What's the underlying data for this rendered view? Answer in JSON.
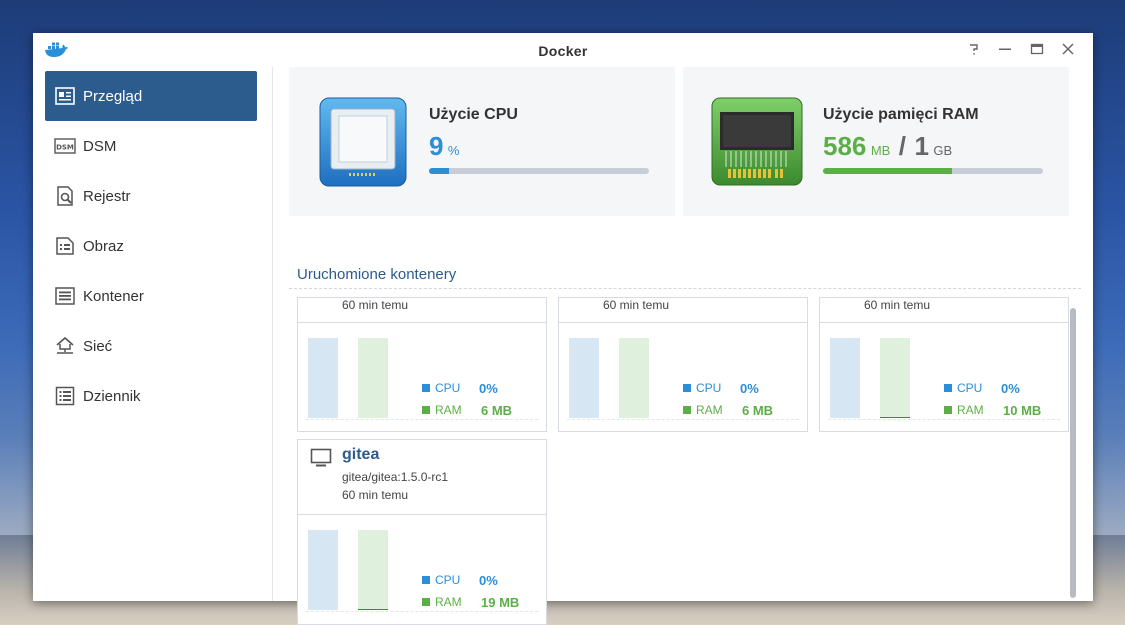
{
  "window": {
    "title": "Docker"
  },
  "colors": {
    "accent": "#2c5b8e",
    "cpu": "#2a8fd6",
    "ram": "#5caf47"
  },
  "sidebar": {
    "items": [
      {
        "label": "Przegląd",
        "icon": "overview-icon",
        "active": true
      },
      {
        "label": "DSM",
        "icon": "dsm-icon"
      },
      {
        "label": "Rejestr",
        "icon": "registry-icon"
      },
      {
        "label": "Obraz",
        "icon": "image-icon"
      },
      {
        "label": "Kontener",
        "icon": "container-icon"
      },
      {
        "label": "Sieć",
        "icon": "network-icon"
      },
      {
        "label": "Dziennik",
        "icon": "log-icon"
      }
    ]
  },
  "cpu_panel": {
    "title": "Użycie CPU",
    "value": "9",
    "unit": "%",
    "usage_fraction": 0.09
  },
  "ram_panel": {
    "title": "Użycie pamięci RAM",
    "used": "586",
    "used_unit": "MB",
    "separator": "/",
    "total": "1",
    "total_unit": "GB",
    "usage_fraction": 0.586
  },
  "containers_section": {
    "title": "Uruchomione kontenery"
  },
  "containers": [
    {
      "time": "60 min temu",
      "cpu_label": "CPU",
      "cpu_value": "0%",
      "ram_label": "RAM",
      "ram_value": "6 MB"
    },
    {
      "time": "60 min temu",
      "cpu_label": "CPU",
      "cpu_value": "0%",
      "ram_label": "RAM",
      "ram_value": "6 MB"
    },
    {
      "time": "60 min temu",
      "cpu_label": "CPU",
      "cpu_value": "0%",
      "ram_label": "RAM",
      "ram_value": "10 MB"
    },
    {
      "name": "gitea",
      "image": "gitea/gitea:1.5.0-rc1",
      "time": "60 min temu",
      "cpu_label": "CPU",
      "cpu_value": "0%",
      "ram_label": "RAM",
      "ram_value": "19 MB"
    }
  ]
}
